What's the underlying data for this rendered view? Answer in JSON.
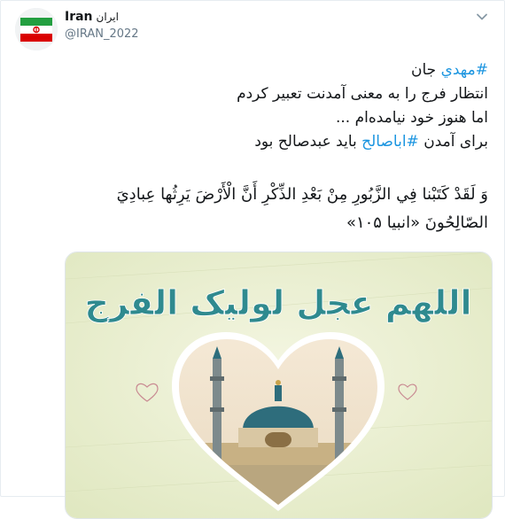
{
  "author": {
    "display_name": "Iran",
    "display_name_fa": "ایران",
    "handle": "@IRAN_2022"
  },
  "tweet": {
    "line1": {
      "hashtag": "#مهدي",
      "text": " جان"
    },
    "line2": "انتظار فرج را به معنی آمدنت تعبیر کردم",
    "line3": "اما هنوز خود نیامده‌ام ...",
    "line4": {
      "before": "برای آمدن ",
      "hashtag": "#اباصالح",
      "after": " باید عبدصالح بود"
    },
    "quran_line1": "وَ لَقَدْ كَتَبْنا فِي الزَّبُورِ مِنْ بَعْدِ الذِّكْرِ أَنَّ الْأَرْضَ يَرِثُها عِبادِيَ",
    "quran_line2": "الصّالِحُونَ «انبیا ۱۰۵»"
  },
  "media": {
    "calligraphy": "اللهم عجل لولیک الفرج",
    "colors": {
      "background": "#e6ecc9",
      "calligraphy": "#2f8a8f",
      "heart_border": "#ffffff",
      "dome": "#2e6d7c"
    }
  },
  "icons": {
    "menu": "chevron-down-icon",
    "avatar": "iran-flag-avatar"
  }
}
